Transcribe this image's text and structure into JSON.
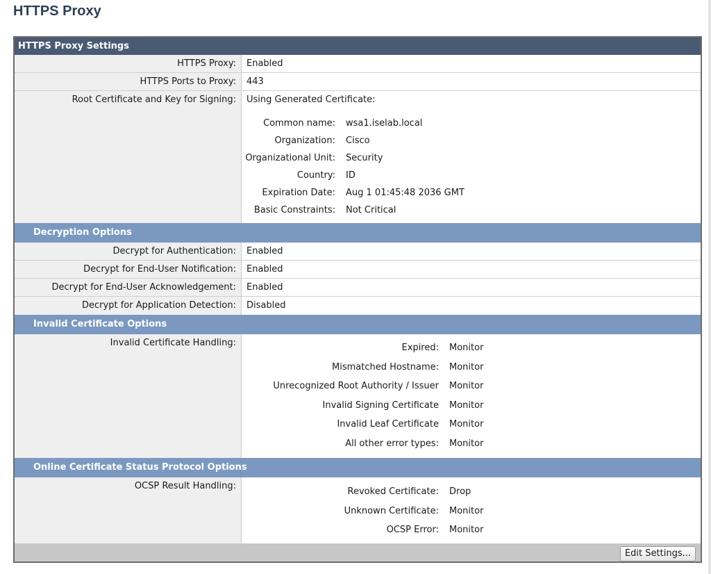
{
  "page": {
    "title": "HTTPS Proxy"
  },
  "panel": {
    "title": "HTTPS Proxy Settings"
  },
  "general": [
    {
      "label": "HTTPS Proxy:",
      "value": "Enabled"
    },
    {
      "label": "HTTPS Ports to Proxy:",
      "value": "443"
    }
  ],
  "root_cert": {
    "label": "Root Certificate and Key for Signing:",
    "value": "Using Generated Certificate:",
    "details": [
      {
        "key": "Common name:",
        "value": "wsa1.iselab.local"
      },
      {
        "key": "Organization:",
        "value": "Cisco"
      },
      {
        "key": "Organizational Unit:",
        "value": "Security"
      },
      {
        "key": "Country:",
        "value": "ID"
      },
      {
        "key": "Expiration Date:",
        "value": "Aug 1 01:45:48 2036 GMT"
      },
      {
        "key": "Basic Constraints:",
        "value": "Not Critical"
      }
    ]
  },
  "decryption": {
    "title": "Decryption Options",
    "rows": [
      {
        "label": "Decrypt for Authentication:",
        "value": "Enabled"
      },
      {
        "label": "Decrypt for End-User Notification:",
        "value": "Enabled"
      },
      {
        "label": "Decrypt for End-User Acknowledgement:",
        "value": "Enabled"
      },
      {
        "label": "Decrypt for Application Detection:",
        "value": "Disabled"
      }
    ]
  },
  "invalid_cert": {
    "title": "Invalid Certificate Options",
    "label": "Invalid Certificate Handling:",
    "items": [
      {
        "key": "Expired:",
        "value": "Monitor"
      },
      {
        "key": "Mismatched Hostname:",
        "value": "Monitor"
      },
      {
        "key": "Unrecognized Root Authority / Issuer",
        "value": "Monitor"
      },
      {
        "key": "Invalid Signing Certificate",
        "value": "Monitor"
      },
      {
        "key": "Invalid Leaf Certificate",
        "value": "Monitor"
      },
      {
        "key": "All other error types:",
        "value": "Monitor"
      }
    ]
  },
  "ocsp": {
    "title": "Online Certificate Status Protocol Options",
    "label": "OCSP Result Handling:",
    "items": [
      {
        "key": "Revoked Certificate:",
        "value": "Drop"
      },
      {
        "key": "Unknown Certificate:",
        "value": "Monitor"
      },
      {
        "key": "OCSP Error:",
        "value": "Monitor"
      }
    ]
  },
  "footer": {
    "edit_button": "Edit Settings..."
  }
}
